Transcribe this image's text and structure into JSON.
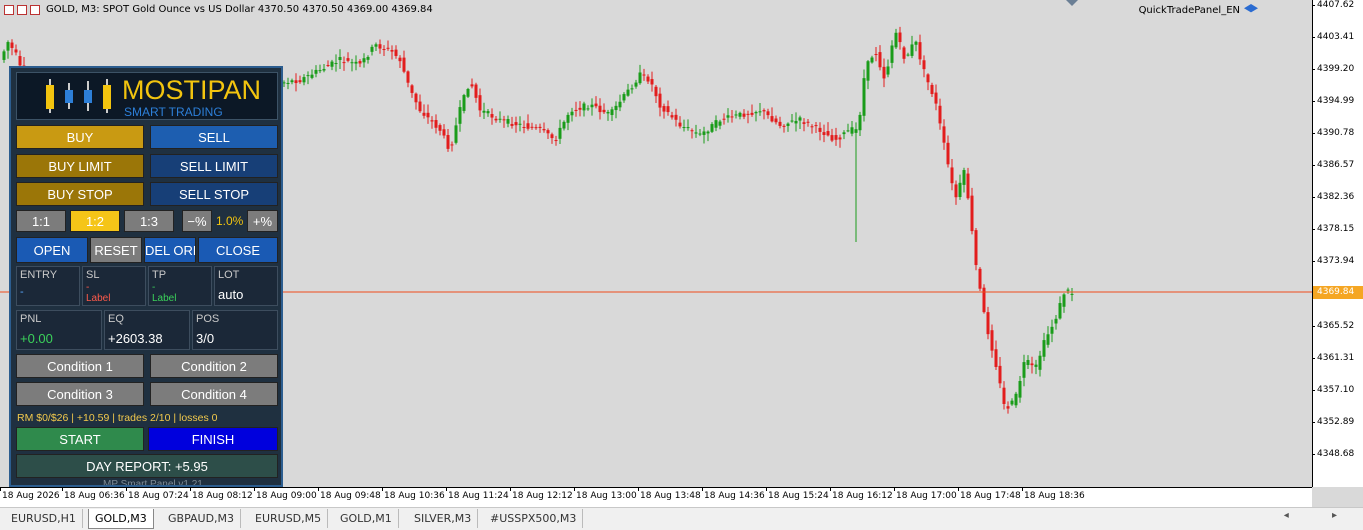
{
  "chart": {
    "symbol_title": "GOLD, M3:  SPOT Gold Ounce vs US Dollar  4370.50 4370.50 4369.00 4369.84",
    "panel_name": "QuickTradePanel_EN",
    "current_price": "4369.84",
    "colors": {
      "bull": "#1a9c1a",
      "bear": "#e21d1d",
      "price_line": "#f04a1a"
    }
  },
  "y_axis": [
    "4407.62",
    "4403.41",
    "4399.20",
    "4394.99",
    "4390.78",
    "4386.57",
    "4382.36",
    "4378.15",
    "4373.94",
    "4365.52",
    "4361.31",
    "4357.10",
    "4352.89",
    "4348.68"
  ],
  "x_axis": [
    "18 Aug 2026",
    "18 Aug 06:36",
    "18 Aug 07:24",
    "18 Aug 08:12",
    "18 Aug 09:00",
    "18 Aug 09:48",
    "18 Aug 10:36",
    "18 Aug 11:24",
    "18 Aug 12:12",
    "18 Aug 13:00",
    "18 Aug 13:48",
    "18 Aug 14:36",
    "18 Aug 15:24",
    "18 Aug 16:12",
    "18 Aug 17:00",
    "18 Aug 17:48",
    "18 Aug 18:36"
  ],
  "tabs": [
    "EURUSD,H1",
    "GOLD,M3",
    "GBPAUD,M3",
    "EURUSD,M5",
    "GOLD,M1",
    "SILVER,M3",
    "#USSPX500,M3"
  ],
  "tab_arrows": "◂ ▸",
  "panel": {
    "logo_title": "MOSTIPAN",
    "logo_subtitle": "SMART TRADING",
    "buy": "BUY",
    "sell": "SELL",
    "buy_limit": "BUY LIMIT",
    "sell_limit": "SELL LIMIT",
    "buy_stop": "BUY STOP",
    "sell_stop": "SELL STOP",
    "rr1": "1:1",
    "rr2": "1:2",
    "rr3": "1:3",
    "minus_pct": "−%",
    "risk_pct": "1.0%",
    "plus_pct": "+%",
    "open": "OPEN",
    "reset": "RESET",
    "del_ord": "DEL ORD",
    "close": "CLOSE",
    "entry_label": "ENTRY",
    "entry_value": "-",
    "sl_label": "SL",
    "sl_value": "-",
    "sl_sub": "Label",
    "tp_label": "TP",
    "tp_value": "-",
    "tp_sub": "Label",
    "lot_label": "LOT",
    "lot_value": "auto",
    "pnl_label": "PNL",
    "pnl_value": "+0.00",
    "eq_label": "EQ",
    "eq_value": "+2603.38",
    "pos_label": "POS",
    "pos_value": "3/0",
    "cond1": "Condition 1",
    "cond2": "Condition 2",
    "cond3": "Condition 3",
    "cond4": "Condition 4",
    "status": "RM $0/$26 | +10.59 | trades 2/10 | losses 0",
    "start": "START",
    "finish": "FINISH",
    "day_report": "DAY REPORT: +5.95",
    "version": "MP Smart Panel v1.21"
  }
}
